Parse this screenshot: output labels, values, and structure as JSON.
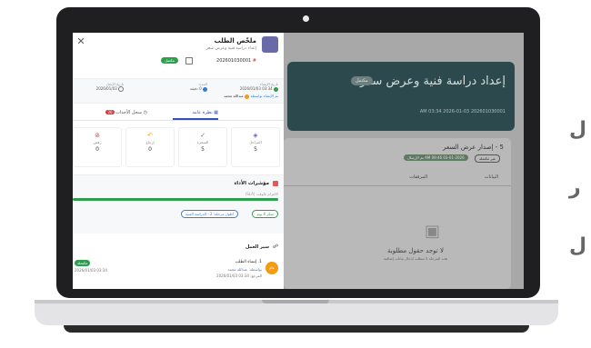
{
  "colors": {
    "brand": "#3a4fbf",
    "success": "#2e9e4e",
    "danger": "#d83a3a",
    "warning": "#f39c12",
    "hero": "#2c4a4e"
  },
  "background_page": {
    "hero_title": "إعداد دراسة فنية وعرض سعر",
    "hero_badge": "مكتمل",
    "hero_meta": "AM 03:34 2026-01-03   202601030001",
    "panel_title": "5 - إصدار عرض السعر",
    "panel_pill_green": "تم الإرسال  AM 09:46 03-01-2026",
    "panel_pill_outline": "غير مكتملة",
    "tab_data": "البيانات",
    "tab_attachments": "المرفقات",
    "empty_title": "لا توجد حقول مطلوبة",
    "empty_subtitle": "هذه المرحلة لا تتطلب إدخال بيانات إضافية"
  },
  "drawer": {
    "title": "ملخّص الطلب",
    "subtitle": "إعداد دراسة فنية وعرض سعر",
    "ref_number": "202601030001",
    "status": "مكتمل",
    "info": {
      "created_label": "تاريخ الإنشاء",
      "created_value": "03:34 2026/01/03",
      "duration_label": "المدة",
      "duration_value": "0 دقيقة",
      "completed_label": "تاريخ الإنجاز",
      "completed_value": "2026/01/03",
      "assignee_label": "تم الإنشاء بواسطة",
      "assignee_value": "عبدالله محمد"
    },
    "tabs": {
      "overview": "نظرة عامة",
      "history": "سجل الأحداث",
      "history_count": "20"
    },
    "stats": [
      {
        "label": "المراحل",
        "value": "5",
        "icon": "layers-icon",
        "color": "#7b5cc8"
      },
      {
        "label": "المنجزة",
        "value": "5",
        "icon": "check-circle-icon",
        "color": "#2e9e4e"
      },
      {
        "label": "إرجاع",
        "value": "0",
        "icon": "undo-icon",
        "color": "#f39c12"
      },
      {
        "label": "رفض",
        "value": "0",
        "icon": "cancel-icon",
        "color": "#d83a3a"
      }
    ],
    "performance": {
      "title": "مؤشرات الأداء",
      "subtitle": "الالتزام بالوقت (SLA)",
      "progress": 1.0,
      "chip_green": "مبكر 4 يوم",
      "chip_blue": "أطول مرحلة: 2 - الدراسة الفنية"
    },
    "workflow": {
      "title": "سير العمل",
      "step_title": "1. إنشاء الطلب",
      "step_user": "بواسطة: عبدالله محمد",
      "step_date": "المرجع: 03:34 2026/01/03",
      "step_avatar": "عام",
      "step_status": "مكتملة",
      "step_timestamp": "03:34 2026/01/03"
    }
  },
  "side_glyphs": [
    "ل",
    "ر",
    "ل"
  ]
}
